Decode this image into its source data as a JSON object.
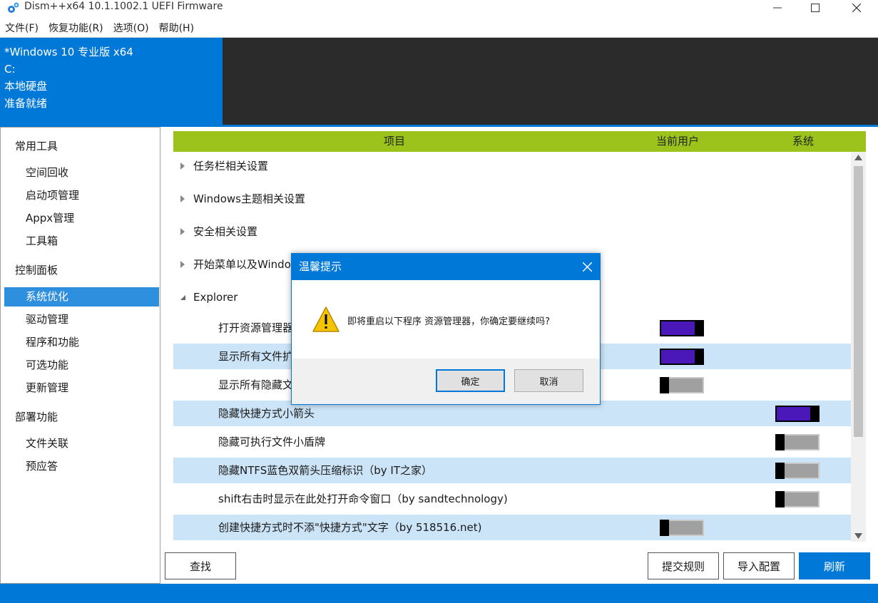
{
  "window": {
    "title": "Dism++x64 10.1.1002.1 UEFI Firmware",
    "icons": {
      "app": "gear-icon",
      "minimize": "minimize-icon",
      "maximize": "maximize-icon",
      "close": "close-icon"
    }
  },
  "menu": [
    "文件(F)",
    "恢复功能(R)",
    "选项(O)",
    "帮助(H)"
  ],
  "system_info": {
    "os": "*Windows 10 专业版 x64",
    "drive": "C:",
    "disk_type": "本地硬盘",
    "status": "准备就绪"
  },
  "sidebar": {
    "groups": [
      {
        "label": "常用工具",
        "items": [
          "空间回收",
          "启动项管理",
          "Appx管理",
          "工具箱"
        ]
      },
      {
        "label": "控制面板",
        "items": [
          "系统优化",
          "驱动管理",
          "程序和功能",
          "可选功能",
          "更新管理"
        ]
      },
      {
        "label": "部署功能",
        "items": [
          "文件关联",
          "预应答"
        ]
      }
    ],
    "active_item": "系统优化"
  },
  "table": {
    "headers": {
      "item": "项目",
      "current_user": "当前用户",
      "system": "系统"
    },
    "groups": [
      {
        "label": "任务栏相关设置",
        "expanded": false
      },
      {
        "label": "Windows主题相关设置",
        "expanded": false
      },
      {
        "label": "安全相关设置",
        "expanded": false
      },
      {
        "label": "开始菜单以及Windo",
        "expanded": false
      },
      {
        "label": "Explorer",
        "expanded": true
      }
    ],
    "rows": [
      {
        "label": "打开资源管理器",
        "user": "on",
        "system": null
      },
      {
        "label": "显示所有文件扩",
        "user": "on",
        "system": null
      },
      {
        "label": "显示所有隐藏文",
        "user": "off",
        "system": null
      },
      {
        "label": "隐藏快捷方式小箭头",
        "user": null,
        "system": "on"
      },
      {
        "label": "隐藏可执行文件小盾牌",
        "user": null,
        "system": "off"
      },
      {
        "label": "隐藏NTFS蓝色双箭头压缩标识（by IT之家）",
        "user": null,
        "system": "off"
      },
      {
        "label": "shift右击时显示在此处打开命令窗口（by sandtechnology)",
        "user": null,
        "system": "off"
      },
      {
        "label": "创建快捷方式时不添\"快捷方式\"文字（by 518516.net)",
        "user": "off",
        "system": null
      }
    ]
  },
  "buttons": {
    "find": "查找",
    "submit_rule": "提交规则",
    "import_config": "导入配置",
    "refresh": "刷新"
  },
  "dialog": {
    "title": "温馨提示",
    "message": "即将重启以下程序 资源管理器，你确定要继续吗?",
    "ok": "确定",
    "cancel": "取消",
    "icon": "warning-icon"
  },
  "colors": {
    "accent": "#0078d7",
    "header_dark": "#2b2b2b",
    "table_header": "#9bc31b",
    "row_highlight": "#cce4f7",
    "toggle_on": "#4a18b8",
    "sidebar_active": "#2d8fdd"
  }
}
